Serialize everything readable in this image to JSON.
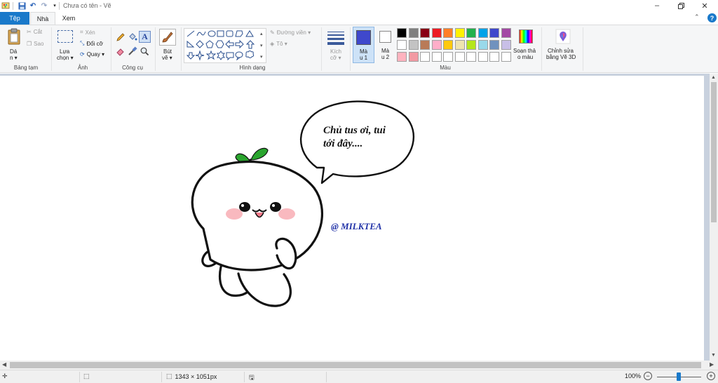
{
  "window": {
    "title": "Chưa có tên - Vẽ"
  },
  "tabs": [
    {
      "label": "Tệp"
    },
    {
      "label": "Nhà"
    },
    {
      "label": "Xem"
    }
  ],
  "ribbon": {
    "clipboard": {
      "paste_line1": "Dá",
      "paste_line2": "n ▾",
      "cut": "Cắt",
      "copy": "Sao",
      "group_label": "Bảng tạm"
    },
    "image": {
      "select_line1": "Lựa",
      "select_line2": "chọn ▾",
      "crop": "Xén",
      "resize": "Đổi cỡ",
      "rotate": "Quay ▾",
      "group_label": "Ảnh"
    },
    "tools": {
      "group_label": "Công cụ"
    },
    "brushes": {
      "line1": "Bút",
      "line2": "vẽ ▾"
    },
    "shapes": {
      "outline": "Đường viền ▾",
      "fill": "Tô ▾",
      "group_label": "Hình dạng"
    },
    "size": {
      "line1": "Kích",
      "line2": "cỡ ▾"
    },
    "color1": {
      "line1": "Mà",
      "line2": "u 1"
    },
    "color2": {
      "line1": "Mà",
      "line2": "u 2"
    },
    "colors": {
      "group_label": "Màu"
    },
    "edit_colors": {
      "line1": "Soạn thả",
      "line2": "o màu"
    },
    "paint3d": {
      "line1": "Chỉnh sửa",
      "line2": "bằng Vẽ 3D"
    }
  },
  "palette": {
    "row1": [
      "#000000",
      "#7f7f7f",
      "#880015",
      "#ed1c24",
      "#ff7f27",
      "#fff200",
      "#22b14c",
      "#00a2e8",
      "#3f48cc",
      "#a349a4"
    ],
    "row2": [
      "#ffffff",
      "#c3c3c3",
      "#b97a57",
      "#ffaec9",
      "#ffc90e",
      "#efe4b0",
      "#b5e61d",
      "#99d9ea",
      "#7092be",
      "#c8bfe7"
    ],
    "row3": [
      "#ffb3bf",
      "#f29aa3",
      "#ffffff",
      "#ffffff",
      "#ffffff",
      "#ffffff",
      "#ffffff",
      "#ffffff",
      "#ffffff",
      "#ffffff"
    ],
    "color1": "#3f48cc",
    "color2": "#ffffff"
  },
  "canvas": {
    "speech_line1": "Chủ tus ơi, tui",
    "speech_line2": "tới đây....",
    "watermark": "@ MILKTEA"
  },
  "status": {
    "dimensions": "1343 × 1051px",
    "zoom": "100%"
  },
  "colors": {
    "accent": "#1979ca",
    "canvas_bg": "#c8d1de",
    "sprout": "#2aa52e",
    "blush": "#f9b9bf",
    "watermark": "#2233a8"
  }
}
